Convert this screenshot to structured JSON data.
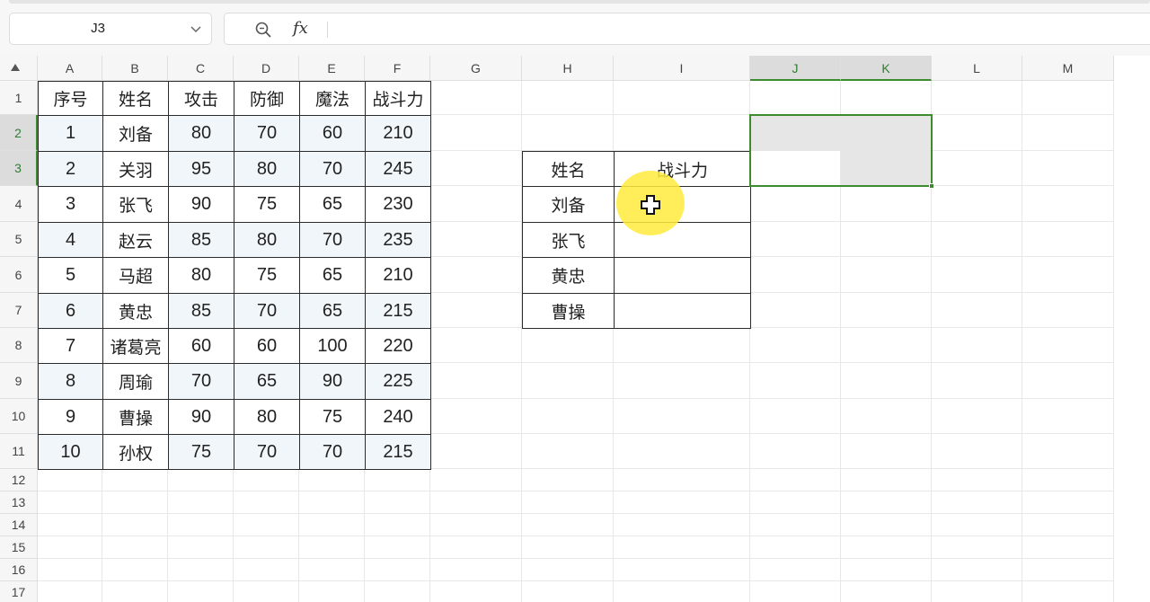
{
  "name_box": {
    "value": "J3"
  },
  "formula_bar": {
    "fx_label": "fx",
    "value": ""
  },
  "columns": [
    "A",
    "B",
    "C",
    "D",
    "E",
    "F",
    "G",
    "H",
    "I",
    "J",
    "K",
    "L",
    "M"
  ],
  "rows": [
    "1",
    "2",
    "3",
    "4",
    "5",
    "6",
    "7",
    "8",
    "9",
    "10",
    "11",
    "12",
    "13",
    "14",
    "15",
    "16",
    "17"
  ],
  "selected_columns": [
    "J",
    "K"
  ],
  "selected_rows": [
    "2",
    "3"
  ],
  "table1": {
    "headers": [
      "序号",
      "姓名",
      "攻击",
      "防御",
      "魔法",
      "战斗力"
    ],
    "rows": [
      [
        "1",
        "刘备",
        "80",
        "70",
        "60",
        "210"
      ],
      [
        "2",
        "关羽",
        "95",
        "80",
        "70",
        "245"
      ],
      [
        "3",
        "张飞",
        "90",
        "75",
        "65",
        "230"
      ],
      [
        "4",
        "赵云",
        "85",
        "80",
        "70",
        "235"
      ],
      [
        "5",
        "马超",
        "80",
        "75",
        "65",
        "210"
      ],
      [
        "6",
        "黄忠",
        "85",
        "70",
        "65",
        "215"
      ],
      [
        "7",
        "诸葛亮",
        "60",
        "60",
        "100",
        "220"
      ],
      [
        "8",
        "周瑜",
        "70",
        "65",
        "90",
        "225"
      ],
      [
        "9",
        "曹操",
        "90",
        "80",
        "75",
        "240"
      ],
      [
        "10",
        "孙权",
        "75",
        "70",
        "70",
        "215"
      ]
    ]
  },
  "table2": {
    "headers": [
      "姓名",
      "战斗力"
    ],
    "rows": [
      [
        "刘备",
        ""
      ],
      [
        "张飞",
        ""
      ],
      [
        "黄忠",
        ""
      ],
      [
        "曹操",
        ""
      ]
    ]
  },
  "icons": {
    "name_box_dropdown": "chevron-down-icon",
    "zoom": "zoom-icon",
    "cursor": "cell-cursor-icon",
    "select_all": "select-all-icon"
  },
  "colors": {
    "selection": "#3d8b2f",
    "header_bg": "#f6f6f6",
    "band_fill": "#f1f6fa",
    "cursor_highlight": "#ffeb3c"
  }
}
